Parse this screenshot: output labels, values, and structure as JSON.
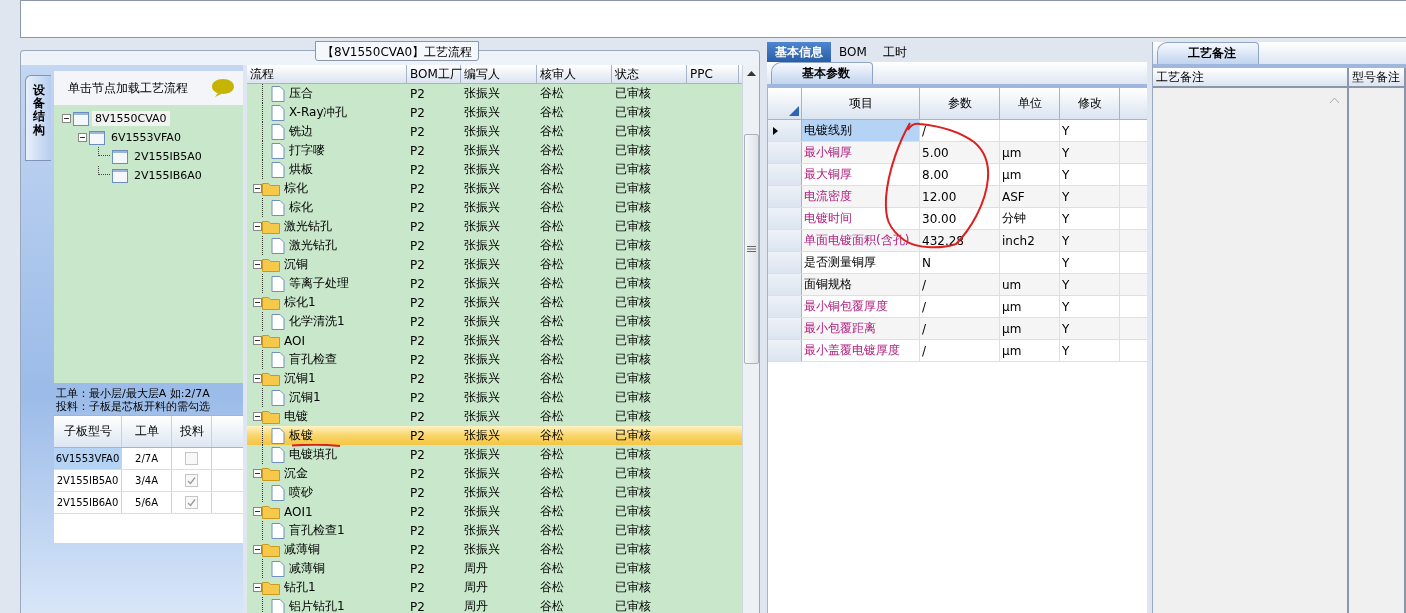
{
  "left_panel": {
    "side_tab": "设备结构",
    "hint": "单击节点加载工艺流程",
    "tree": [
      {
        "label": "8V1550CVA0",
        "selected": true,
        "expanded": true,
        "children": [
          {
            "label": "6V1553VFA0",
            "selected": false,
            "expanded": true,
            "children": [
              {
                "label": "2V155IB5A0",
                "selected": false
              },
              {
                "label": "2V155IB6A0",
                "selected": false
              }
            ]
          }
        ]
      }
    ],
    "notes": [
      "工单：最小层/最大层A 如:2/7A",
      "投料：子板是芯板开料的需勾选"
    ],
    "board_table": {
      "columns": [
        "子板型号",
        "工单",
        "投料"
      ],
      "rows": [
        {
          "model": "6V1553VFA0",
          "order": "2/7A",
          "feed": false,
          "selected": true
        },
        {
          "model": "2V155IB5A0",
          "order": "3/4A",
          "feed": true,
          "selected": false
        },
        {
          "model": "2V155IB6A0",
          "order": "5/6A",
          "feed": true,
          "selected": false
        }
      ]
    }
  },
  "process_flow": {
    "title": "【8V1550CVA0】工艺流程",
    "columns": [
      "流程",
      "BOM工厂",
      "编写人",
      "核审人",
      "状态",
      "PPC"
    ],
    "rows": [
      {
        "kind": "offscreen",
        "children": [
          {
            "kind": "file",
            "name": "压合",
            "factory": "P2",
            "author": "张振兴",
            "reviewer": "谷松",
            "status": "已审核",
            "selected": false
          },
          {
            "kind": "file",
            "name": "X-Ray冲孔",
            "factory": "P2",
            "author": "张振兴",
            "reviewer": "谷松",
            "status": "已审核",
            "selected": false
          },
          {
            "kind": "file",
            "name": "铣边",
            "factory": "P2",
            "author": "张振兴",
            "reviewer": "谷松",
            "status": "已审核",
            "selected": false
          },
          {
            "kind": "file",
            "name": "打字嘜",
            "factory": "P2",
            "author": "张振兴",
            "reviewer": "谷松",
            "status": "已审核",
            "selected": false
          },
          {
            "kind": "file",
            "name": "烘板",
            "factory": "P2",
            "author": "张振兴",
            "reviewer": "谷松",
            "status": "已审核",
            "selected": false
          }
        ]
      },
      {
        "kind": "folder",
        "name": "棕化",
        "factory": "P2",
        "author": "张振兴",
        "reviewer": "谷松",
        "status": "已审核",
        "selected": false,
        "expanded": true,
        "children": [
          {
            "kind": "file",
            "name": "棕化",
            "factory": "P2",
            "author": "张振兴",
            "reviewer": "谷松",
            "status": "已审核",
            "selected": false
          }
        ]
      },
      {
        "kind": "folder",
        "name": "激光钻孔",
        "factory": "P2",
        "author": "张振兴",
        "reviewer": "谷松",
        "status": "已审核",
        "selected": false,
        "expanded": true,
        "children": [
          {
            "kind": "file",
            "name": "激光钻孔",
            "factory": "P2",
            "author": "张振兴",
            "reviewer": "谷松",
            "status": "已审核",
            "selected": false
          }
        ]
      },
      {
        "kind": "folder",
        "name": "沉铜",
        "factory": "P2",
        "author": "张振兴",
        "reviewer": "谷松",
        "status": "已审核",
        "selected": false,
        "expanded": true,
        "children": [
          {
            "kind": "file",
            "name": "等离子处理",
            "factory": "P2",
            "author": "张振兴",
            "reviewer": "谷松",
            "status": "已审核",
            "selected": false
          }
        ]
      },
      {
        "kind": "folder",
        "name": "棕化1",
        "factory": "P2",
        "author": "张振兴",
        "reviewer": "谷松",
        "status": "已审核",
        "selected": false,
        "expanded": true,
        "children": [
          {
            "kind": "file",
            "name": "化学清洗1",
            "factory": "P2",
            "author": "张振兴",
            "reviewer": "谷松",
            "status": "已审核",
            "selected": false
          }
        ]
      },
      {
        "kind": "folder",
        "name": "AOI",
        "factory": "P2",
        "author": "张振兴",
        "reviewer": "谷松",
        "status": "已审核",
        "selected": false,
        "expanded": true,
        "children": [
          {
            "kind": "file",
            "name": "盲孔检查",
            "factory": "P2",
            "author": "张振兴",
            "reviewer": "谷松",
            "status": "已审核",
            "selected": false
          }
        ]
      },
      {
        "kind": "folder",
        "name": "沉铜1",
        "factory": "P2",
        "author": "张振兴",
        "reviewer": "谷松",
        "status": "已审核",
        "selected": false,
        "expanded": true,
        "children": [
          {
            "kind": "file",
            "name": "沉铜1",
            "factory": "P2",
            "author": "张振兴",
            "reviewer": "谷松",
            "status": "已审核",
            "selected": false
          }
        ]
      },
      {
        "kind": "folder",
        "name": "电镀",
        "factory": "P2",
        "author": "张振兴",
        "reviewer": "谷松",
        "status": "已审核",
        "selected": false,
        "expanded": true,
        "children": [
          {
            "kind": "file",
            "name": "板镀",
            "factory": "P2",
            "author": "张振兴",
            "reviewer": "谷松",
            "status": "已审核",
            "selected": true,
            "underlined": true
          },
          {
            "kind": "file",
            "name": "电镀填孔",
            "factory": "P2",
            "author": "张振兴",
            "reviewer": "谷松",
            "status": "已审核",
            "selected": false
          }
        ]
      },
      {
        "kind": "folder",
        "name": "沉金",
        "factory": "P2",
        "author": "张振兴",
        "reviewer": "谷松",
        "status": "已审核",
        "selected": false,
        "expanded": true,
        "children": [
          {
            "kind": "file",
            "name": "喷砂",
            "factory": "P2",
            "author": "张振兴",
            "reviewer": "谷松",
            "status": "已审核",
            "selected": false
          }
        ]
      },
      {
        "kind": "folder",
        "name": "AOI1",
        "factory": "P2",
        "author": "张振兴",
        "reviewer": "谷松",
        "status": "已审核",
        "selected": false,
        "expanded": true,
        "children": [
          {
            "kind": "file",
            "name": "盲孔检查1",
            "factory": "P2",
            "author": "张振兴",
            "reviewer": "谷松",
            "status": "已审核",
            "selected": false
          }
        ]
      },
      {
        "kind": "folder",
        "name": "减薄铜",
        "factory": "P2",
        "author": "张振兴",
        "reviewer": "谷松",
        "status": "已审核",
        "selected": false,
        "expanded": true,
        "children": [
          {
            "kind": "file",
            "name": "减薄铜",
            "factory": "P2",
            "author": "周丹",
            "reviewer": "谷松",
            "status": "已审核",
            "selected": false
          }
        ]
      },
      {
        "kind": "folder",
        "name": "钻孔1",
        "factory": "P2",
        "author": "周丹",
        "reviewer": "谷松",
        "status": "已审核",
        "selected": false,
        "expanded": true,
        "children": [
          {
            "kind": "file",
            "name": "铝片钻孔1",
            "factory": "P2",
            "author": "周丹",
            "reviewer": "谷松",
            "status": "已审核",
            "selected": false
          }
        ]
      }
    ]
  },
  "detail": {
    "tabs": [
      {
        "label": "基本信息",
        "selected": true
      },
      {
        "label": "BOM",
        "selected": false
      },
      {
        "label": "工时",
        "selected": false
      }
    ],
    "sub_tab": "基本参数",
    "columns": [
      "项目",
      "参数",
      "单位",
      "修改"
    ],
    "rows": [
      {
        "item": "电镀线别",
        "value": "/",
        "modify": "Y",
        "emphasized": false,
        "selected": true
      },
      {
        "item": "最小铜厚",
        "value": "5.00",
        "unit": "μm",
        "modify": "Y",
        "emphasized": true,
        "selected": false
      },
      {
        "item": "最大铜厚",
        "value": "8.00",
        "unit": "μm",
        "modify": "Y",
        "emphasized": true,
        "selected": false
      },
      {
        "item": "电流密度",
        "value": "12.00",
        "unit": "ASF",
        "modify": "Y",
        "emphasized": true,
        "selected": false
      },
      {
        "item": "电镀时间",
        "value": "30.00",
        "unit": "分钟",
        "modify": "Y",
        "emphasized": true,
        "selected": false
      },
      {
        "item": "单面电镀面积(含孔)",
        "value": "432.28",
        "unit": "inch2",
        "modify": "Y",
        "emphasized": true,
        "selected": false
      },
      {
        "item": "是否测量铜厚",
        "value": "N",
        "modify": "Y",
        "emphasized": false,
        "selected": false
      },
      {
        "item": "面铜规格",
        "value": "/",
        "unit": "um",
        "modify": "Y",
        "emphasized": false,
        "selected": false
      },
      {
        "item": "最小铜包覆厚度",
        "value": "/",
        "unit": "μm",
        "modify": "Y",
        "emphasized": true,
        "selected": false
      },
      {
        "item": "最小包覆距离",
        "value": "/",
        "unit": "μm",
        "modify": "Y",
        "emphasized": true,
        "selected": false
      },
      {
        "item": "最小盖覆电镀厚度",
        "value": "/",
        "unit": "μm",
        "modify": "Y",
        "emphasized": true,
        "selected": false
      }
    ]
  },
  "notes_panel": {
    "tab": "工艺备注",
    "columns": [
      "工艺备注",
      "型号备注"
    ]
  }
}
